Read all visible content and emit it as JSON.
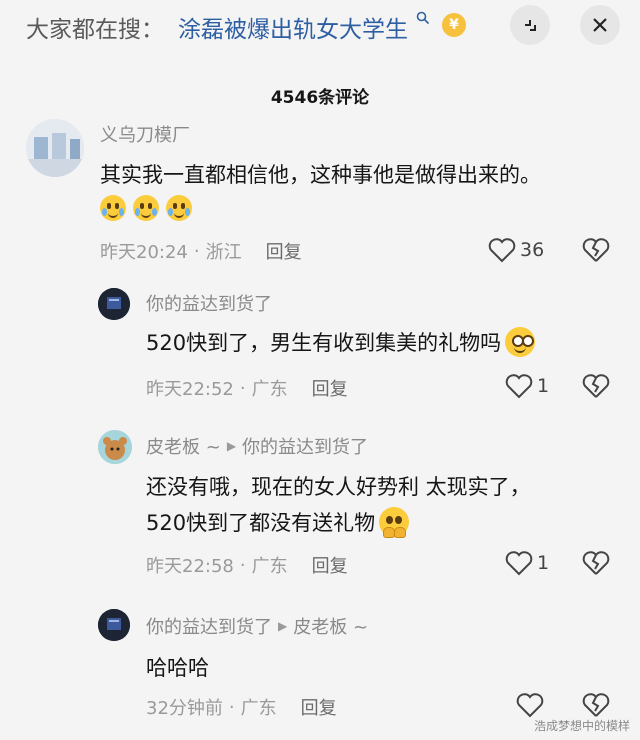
{
  "header": {
    "search_prefix": "大家都在搜：",
    "search_query": "涂磊被爆出轨女大学生",
    "coin_symbol": "¥",
    "icons": [
      "search-icon",
      "coin-icon",
      "minimize-icon",
      "close-icon"
    ]
  },
  "comment_count": "4546条评论",
  "comments": [
    {
      "user": "义乌刀模厂",
      "text": "其实我一直都相信他，这种事他是做得出来的。",
      "emojis": [
        "crying-emoji",
        "crying-emoji",
        "crying-emoji"
      ],
      "time": "昨天20:24",
      "location": "浙江",
      "reply_label": "回复",
      "likes": "36"
    },
    {
      "user": "你的益达到货了",
      "text": "520快到了，男生有收到集美的礼物吗",
      "emoji": "smirk-emoji",
      "time": "昨天22:52",
      "location": "广东",
      "reply_label": "回复",
      "likes": "1"
    },
    {
      "user": "皮老板 ~",
      "reply_to": "你的益达到货了",
      "text_line1": "还没有哦，现在的女人好势利 太现实了，",
      "text_line2": "520快到了都没有送礼物",
      "emoji": "pleading-emoji",
      "time": "昨天22:58",
      "location": "广东",
      "reply_label": "回复",
      "likes": "1"
    },
    {
      "user": "你的益达到货了",
      "reply_to": "皮老板 ~",
      "text": "哈哈哈",
      "time": "32分钟前",
      "location": "广东",
      "reply_label": "回复",
      "likes": ""
    }
  ],
  "watermark": "浩成梦想中的模样",
  "separator": "·",
  "colors": {
    "background": "#f4f4f4",
    "link": "#2f5fa3",
    "meta": "#9a9a9a",
    "emoji": "#fbcc3c"
  }
}
